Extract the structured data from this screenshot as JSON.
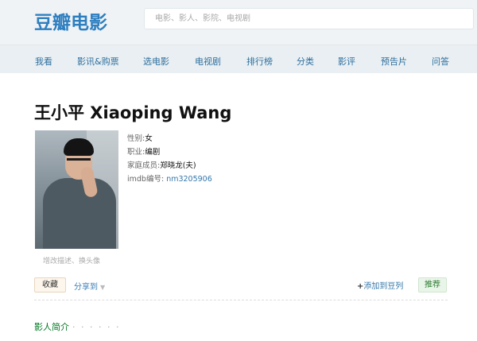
{
  "header": {
    "logo": "豆瓣电影",
    "search_placeholder": "电影、影人、影院、电视剧"
  },
  "nav": {
    "items": [
      "我看",
      "影讯&购票",
      "选电影",
      "电视剧",
      "排行榜",
      "分类",
      "影评",
      "预告片",
      "问答"
    ]
  },
  "person": {
    "title": "王小平 Xiaoping Wang",
    "photo_links": "增改描述、换头像",
    "info": {
      "gender_label": "性别:",
      "gender_value": "女",
      "job_label": "职业:",
      "job_value": "编剧",
      "family_label": "家庭成员:",
      "family_value": "郑晓龙(夫)",
      "imdb_label": "imdb编号:",
      "imdb_value": "nm3205906"
    }
  },
  "actions": {
    "collect": "收藏",
    "share": "分享到",
    "share_caret": "▼",
    "add_plus": "+",
    "add_doulist": "添加到豆列",
    "recommend": "推荐"
  },
  "intro": {
    "heading": "影人简介",
    "dots": "· · · · · ·"
  },
  "colors": {
    "brand": "#2e7fc0",
    "link": "#3377aa",
    "section_green": "#007722"
  }
}
